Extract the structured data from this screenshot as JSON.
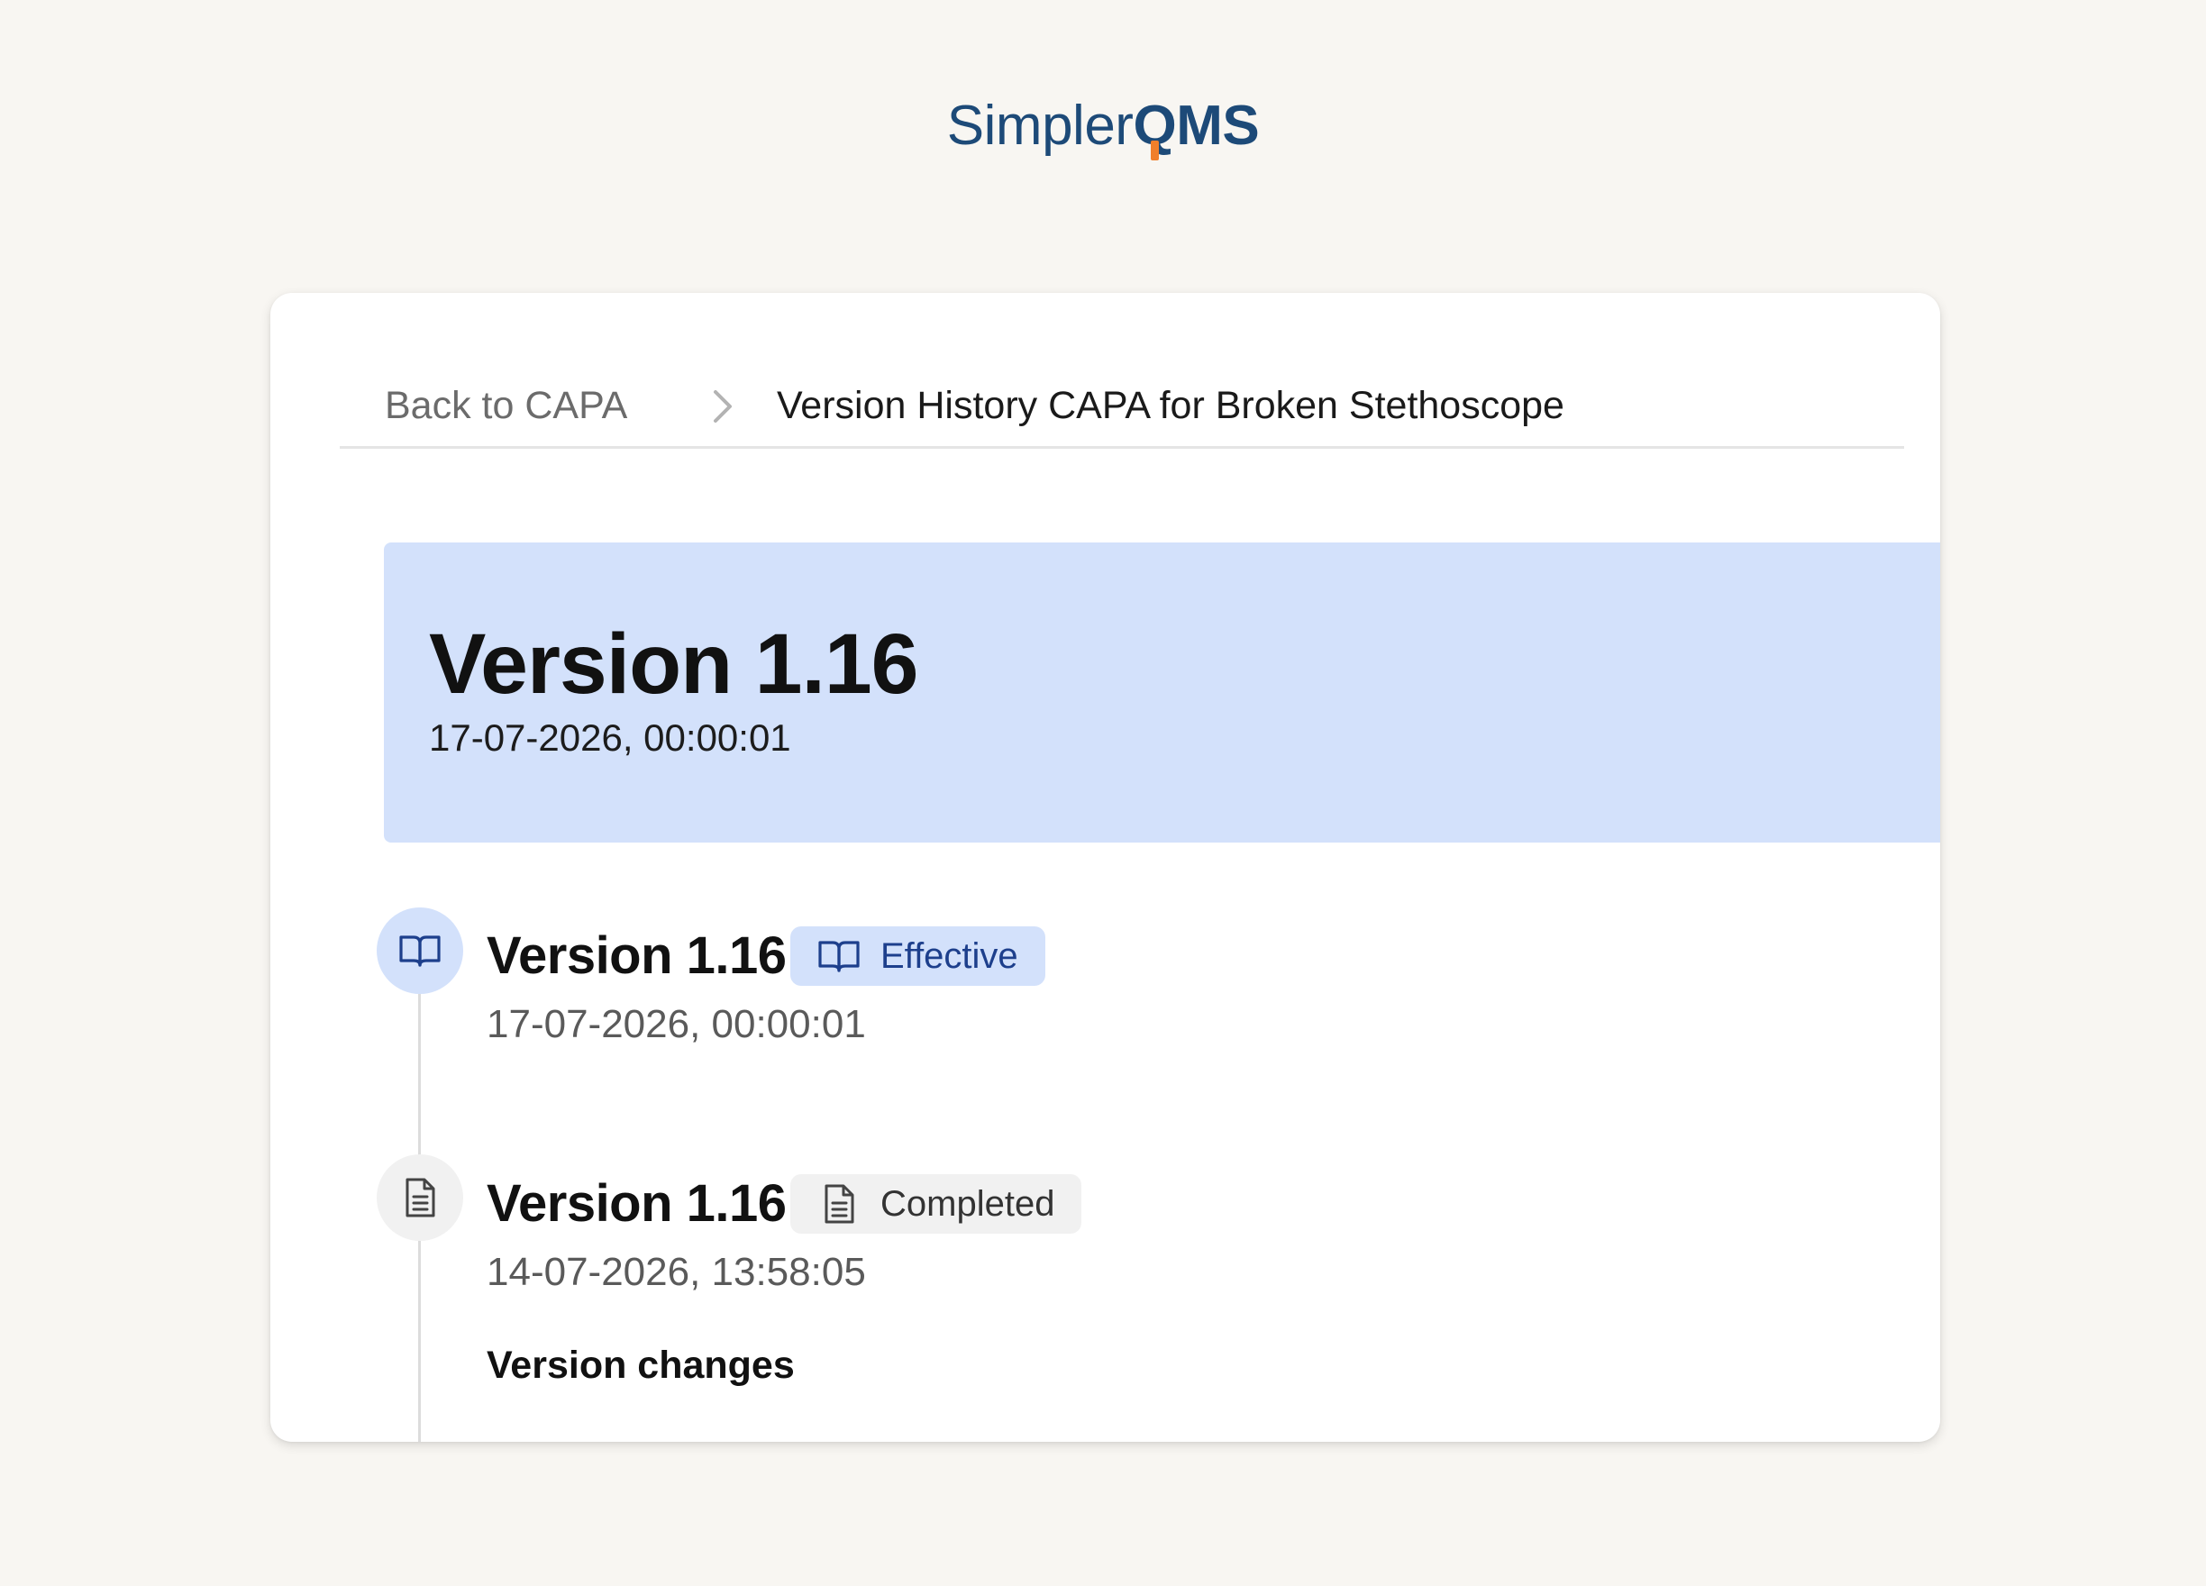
{
  "brand": {
    "name_part1": "Simpler",
    "name_part2_q": "Q",
    "name_part2_rest": "MS",
    "primary_color": "#1d4a78",
    "accent_color": "#f07f2b"
  },
  "breadcrumb": {
    "back_label": "Back to CAPA",
    "separator_icon": "chevron-right-icon",
    "current_label": "Version History CAPA for Broken Stethoscope"
  },
  "header": {
    "title": "Version 1.16",
    "date": "17-07-2026, 00:00:01",
    "background_color": "#d3e1fb"
  },
  "timeline": [
    {
      "icon": "book-open-icon",
      "title": "Version 1.16",
      "status": {
        "label": "Effective",
        "icon": "book-open-icon",
        "color": "#1d3f8c",
        "background": "#d3e1fb"
      },
      "date": "17-07-2026, 00:00:01"
    },
    {
      "icon": "document-icon",
      "title": "Version 1.16",
      "status": {
        "label": "Completed",
        "icon": "document-icon",
        "color": "#333333",
        "background": "#f1f1f1"
      },
      "date": "14-07-2026, 13:58:05",
      "changes_label": "Version changes"
    }
  ]
}
